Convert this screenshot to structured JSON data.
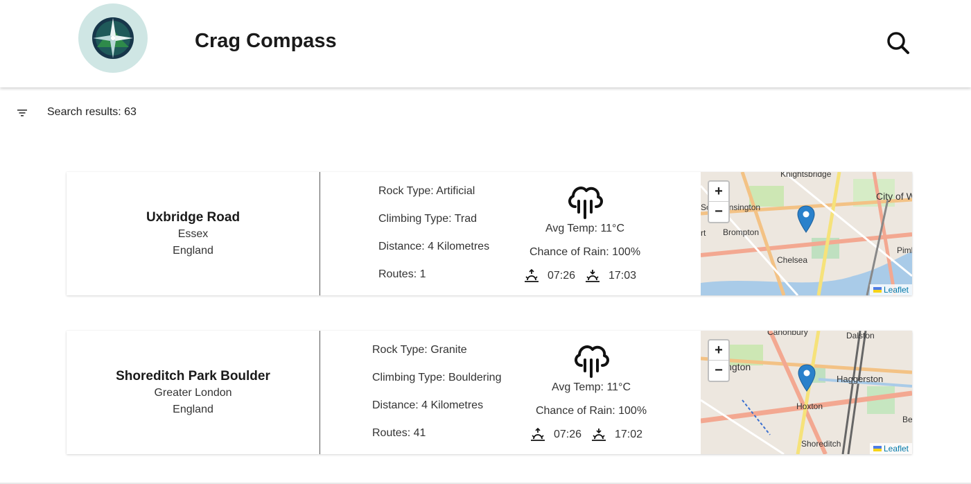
{
  "app": {
    "title": "Crag Compass"
  },
  "search": {
    "icon": "search-icon"
  },
  "results": {
    "label": "Search results: 63"
  },
  "crags": [
    {
      "name": "Uxbridge Road",
      "county": "Essex",
      "country": "England",
      "rock_type": "Rock Type: Artificial",
      "climbing_type": "Climbing Type: Trad",
      "distance": "Distance: 4 Kilometres",
      "routes": "Routes: 1",
      "avg_temp": "Avg Temp: 11°C",
      "rain": "Chance of Rain: 100%",
      "sunrise": "07:26",
      "sunset": "17:03",
      "map": {
        "zoom_in": "+",
        "zoom_out": "−",
        "attribution": "Leaflet",
        "labels": [
          "Knightsbridge",
          "Kensington",
          "City of W",
          "Brompton",
          "Pimli",
          "Chelsea",
          "So",
          "rt"
        ]
      }
    },
    {
      "name": "Shoreditch Park Boulder",
      "county": "Greater London",
      "country": "England",
      "rock_type": "Rock Type: Granite",
      "climbing_type": "Climbing Type: Bouldering",
      "distance": "Distance: 4 Kilometres",
      "routes": "Routes: 41",
      "avg_temp": "Avg Temp: 11°C",
      "rain": "Chance of Rain: 100%",
      "sunrise": "07:26",
      "sunset": "17:02",
      "map": {
        "zoom_in": "+",
        "zoom_out": "−",
        "attribution": "Leaflet",
        "labels": [
          "Canonbury",
          "Dalston",
          "Islington",
          "Haggerston",
          "Hoxton",
          "Be",
          "Shoreditch"
        ]
      }
    }
  ]
}
